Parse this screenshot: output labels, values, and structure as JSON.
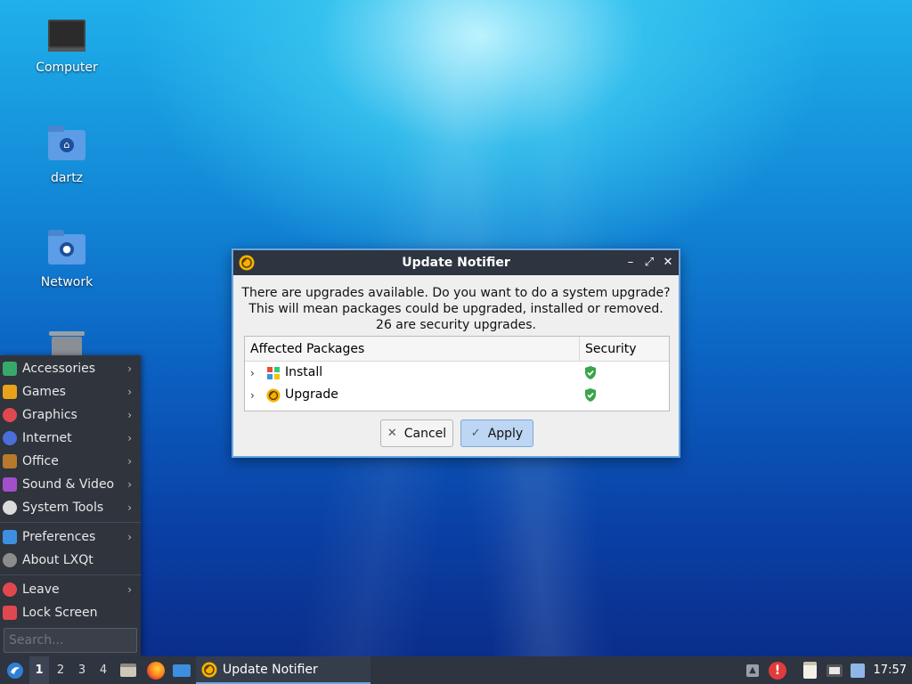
{
  "desktop": {
    "icons": [
      {
        "label": "Computer",
        "icon": "monitor-icon"
      },
      {
        "label": "dartz",
        "icon": "home-folder-icon"
      },
      {
        "label": "Network",
        "icon": "network-folder-icon"
      },
      {
        "label": "",
        "icon": "trash-icon"
      }
    ]
  },
  "dialog": {
    "title": "Update Notifier",
    "message_lines": [
      "There are upgrades available. Do you want to do a system upgrade?",
      "This will mean packages could be upgraded, installed or removed.",
      "26 are security upgrades."
    ],
    "columns": [
      "Affected Packages",
      "Security"
    ],
    "rows": [
      {
        "name": "Install",
        "icon": "install-icon",
        "security_icon": "shield-check-icon"
      },
      {
        "name": "Upgrade",
        "icon": "upgrade-icon",
        "security_icon": "shield-check-icon"
      }
    ],
    "buttons": {
      "cancel": "Cancel",
      "apply": "Apply"
    },
    "window_controls": {
      "minimize": "–",
      "maximize": "⤢",
      "close": "✕"
    }
  },
  "start_menu": {
    "items": [
      {
        "label": "Accessories",
        "color": "#37a86b",
        "submenu": true
      },
      {
        "label": "Games",
        "color": "#e8a21a",
        "submenu": true
      },
      {
        "label": "Graphics",
        "color": "#e0484f",
        "submenu": true
      },
      {
        "label": "Internet",
        "color": "#4a6fd8",
        "submenu": true
      },
      {
        "label": "Office",
        "color": "#b7792c",
        "submenu": true
      },
      {
        "label": "Sound & Video",
        "color": "#a34fc9",
        "submenu": true
      },
      {
        "label": "System Tools",
        "color": "#dcdcdc",
        "submenu": true
      }
    ],
    "items2": [
      {
        "label": "Preferences",
        "color": "#3f8fe0",
        "submenu": true
      },
      {
        "label": "About LXQt",
        "color": "#8c8c8c",
        "submenu": false
      }
    ],
    "items3": [
      {
        "label": "Leave",
        "color": "#e0484f",
        "submenu": true
      },
      {
        "label": "Lock Screen",
        "color": "#e0484f",
        "submenu": false
      }
    ],
    "search_placeholder": "Search..."
  },
  "taskbar": {
    "desktops": [
      "1",
      "2",
      "3",
      "4"
    ],
    "active_desktop": "1",
    "task_title": "Update Notifier",
    "clock": "17:57"
  },
  "colors": {
    "panel": "#2e3440",
    "accent": "#6aa6e0",
    "apply_bg": "#bcd6f3"
  }
}
